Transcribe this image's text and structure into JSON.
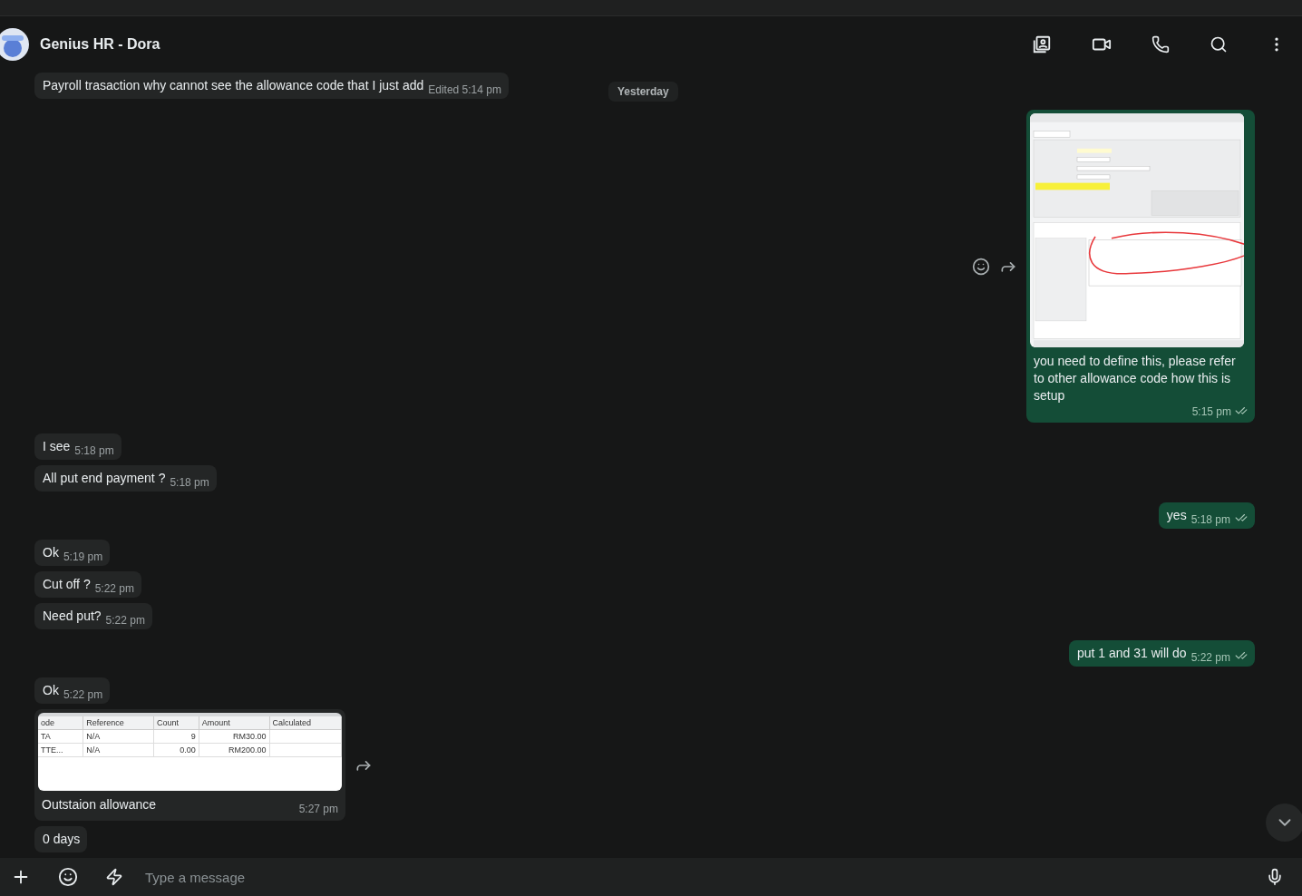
{
  "header": {
    "title": "Genius HR - Dora"
  },
  "date_chip": "Yesterday",
  "messages": [
    {
      "kind": "text",
      "outgoing": false,
      "text": "Payroll trasaction why cannot see the allowance code that I just add",
      "time": "Edited 5:14 pm"
    },
    {
      "kind": "screenshot",
      "outgoing": true,
      "caption": "you need to define this, please refer to other allowance code how this is setup",
      "time": "5:15 pm",
      "read": true
    },
    {
      "kind": "text",
      "outgoing": false,
      "text": "I see",
      "time": "5:18 pm"
    },
    {
      "kind": "text",
      "outgoing": false,
      "text": "All put end payment ?",
      "time": "5:18 pm"
    },
    {
      "kind": "text",
      "outgoing": true,
      "text": "yes",
      "time": "5:18 pm",
      "read": true
    },
    {
      "kind": "text",
      "outgoing": false,
      "text": "Ok",
      "time": "5:19 pm"
    },
    {
      "kind": "text",
      "outgoing": false,
      "text": "Cut off ?",
      "time": "5:22 pm"
    },
    {
      "kind": "text",
      "outgoing": false,
      "text": "Need put?",
      "time": "5:22 pm"
    },
    {
      "kind": "text",
      "outgoing": true,
      "text": "put 1 and 31 will do",
      "time": "5:22 pm",
      "read": true
    },
    {
      "kind": "text",
      "outgoing": false,
      "text": "Ok",
      "time": "5:22 pm"
    },
    {
      "kind": "table",
      "outgoing": false,
      "caption": "Outstaion allowance",
      "time": "5:27 pm",
      "table": {
        "columns": [
          "ode",
          "Reference",
          "Count",
          "Amount",
          "Calculated"
        ],
        "rows": [
          [
            "TA",
            "N/A",
            "9",
            "RM30.00",
            ""
          ],
          [
            "TTE...",
            "N/A",
            "0.00",
            "RM200.00",
            ""
          ]
        ]
      }
    },
    {
      "kind": "text",
      "outgoing": false,
      "text": "0 days"
    }
  ],
  "composer": {
    "placeholder": "Type a message"
  }
}
